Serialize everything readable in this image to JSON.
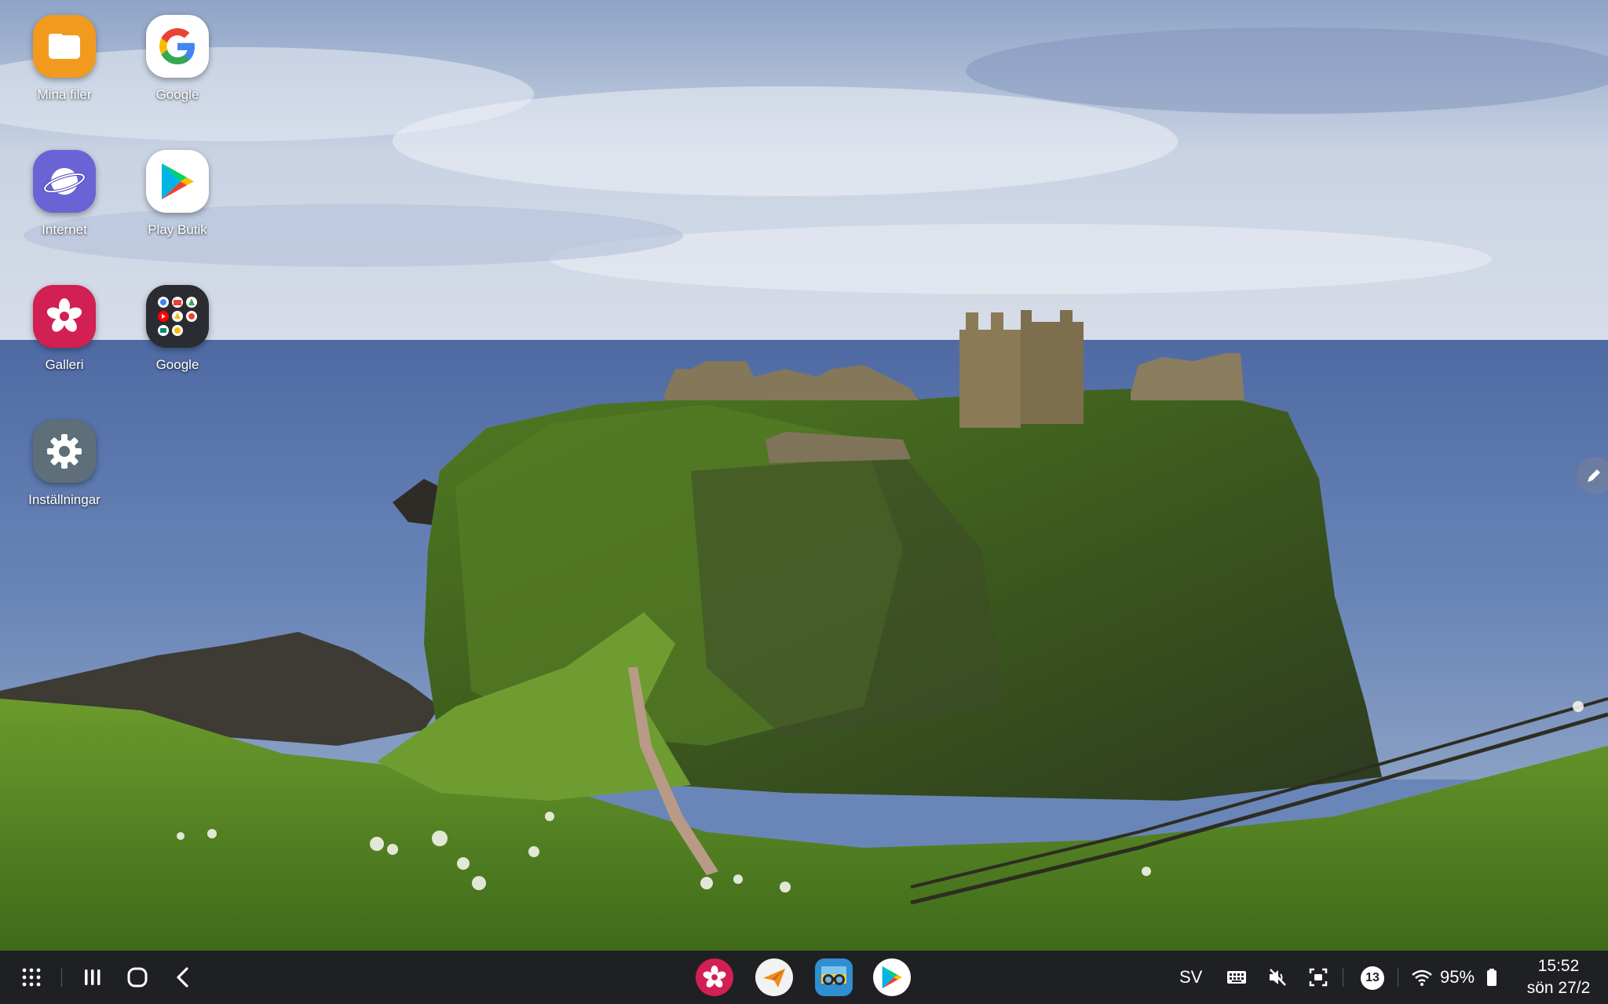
{
  "desktop": {
    "apps": [
      {
        "label": "Mina filer",
        "icon": "folder-icon"
      },
      {
        "label": "Google",
        "icon": "google-g-icon"
      },
      {
        "label": "Internet",
        "icon": "samsung-internet-icon"
      },
      {
        "label": "Play Butik",
        "icon": "play-store-icon"
      },
      {
        "label": "Galleri",
        "icon": "gallery-flower-icon"
      },
      {
        "label": "Google",
        "icon": "google-folder-icon"
      },
      {
        "label": "Inställningar",
        "icon": "gear-icon"
      }
    ]
  },
  "taskbar": {
    "nav": [
      "apps-grid-icon",
      "recents-icon",
      "home-icon",
      "back-icon"
    ],
    "dock": [
      "gallery-flower-icon",
      "paper-plane-app-icon",
      "maps-binoculars-icon",
      "play-store-icon"
    ],
    "status": {
      "language": "SV",
      "notification_count": "13",
      "battery": "95%",
      "time": "15:52",
      "date": "sön 27/2"
    }
  },
  "colors": {
    "taskbar_bg": "#1f2024",
    "folder_orange": "#f29a1e",
    "internet_purple": "#6a63d6",
    "gallery_red": "#d21f54",
    "settings_gray": "#5f6f7a"
  }
}
